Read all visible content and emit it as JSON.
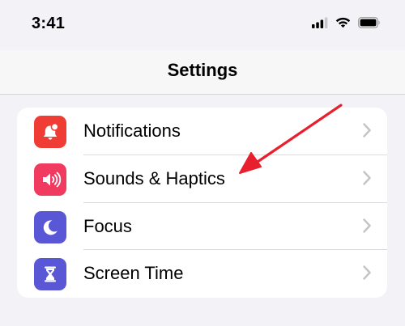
{
  "status_bar": {
    "time": "3:41",
    "icons": [
      "signal-icon",
      "wifi-icon",
      "battery-icon"
    ]
  },
  "nav": {
    "title": "Settings"
  },
  "settings": {
    "items": [
      {
        "label": "Notifications",
        "icon": "notifications-icon",
        "color": "#ef3d35"
      },
      {
        "label": "Sounds & Haptics",
        "icon": "speaker-icon",
        "color": "#f03a5f"
      },
      {
        "label": "Focus",
        "icon": "moon-icon",
        "color": "#5957d6"
      },
      {
        "label": "Screen Time",
        "icon": "hourglass-icon",
        "color": "#5957d6"
      }
    ]
  },
  "annotation": {
    "color": "#e8202e"
  }
}
